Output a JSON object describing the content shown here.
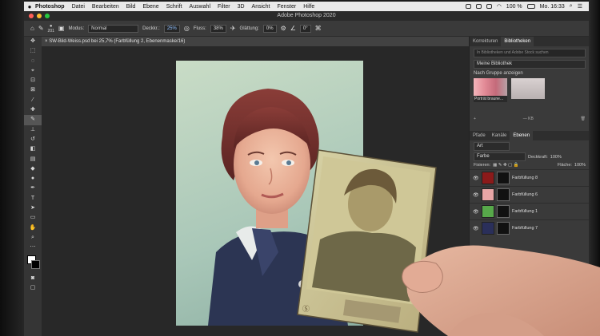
{
  "menubar": {
    "items": [
      "Photoshop",
      "Datei",
      "Bearbeiten",
      "Bild",
      "Ebene",
      "Schrift",
      "Auswahl",
      "Filter",
      "3D",
      "Ansicht",
      "Fenster",
      "Hilfe"
    ],
    "battery": "100 %",
    "clock": "Mo. 16:33"
  },
  "window": {
    "title": "Adobe Photoshop 2020"
  },
  "options": {
    "brush_size": "201",
    "mode_label": "Modus:",
    "mode_value": "Normal",
    "opacity_label": "Deckkr.:",
    "opacity_value": "25%",
    "flow_label": "Fluss:",
    "flow_value": "38%",
    "smoothing_label": "Glättung:",
    "smoothing_value": "0%",
    "angle_value": "0°"
  },
  "document": {
    "tab": "SW-Bild-Weiss.psd bei 25,7% (Farbfüllung 2, Ebenenmaske/16)"
  },
  "libraries": {
    "tabs": [
      "Korrekturen",
      "Bibliotheken"
    ],
    "search_placeholder": "In Bibliotheken und Adobe Stock suchen",
    "library_name": "Meine Bibliothek",
    "group_label": "Nach Gruppe anzeigen",
    "item_label": "Porträt braune...",
    "size_label": "— KB"
  },
  "layers": {
    "tabs": [
      "Pfade",
      "Kanäle",
      "Ebenen"
    ],
    "kind_value": "Art",
    "blend_value": "Farbe",
    "opacity_label": "Deckkraft:",
    "opacity_value": "100%",
    "lock_label": "Fixieren:",
    "fill_label": "Fläche:",
    "fill_value": "100%",
    "rows": [
      {
        "name": "Farbfüllung 8",
        "color": "#8b1a1a"
      },
      {
        "name": "Farbfüllung 6",
        "color": "#e8a6a6"
      },
      {
        "name": "Farbfüllung 1",
        "color": "#57a84a"
      },
      {
        "name": "Farbfüllung 7",
        "color": "#2a2f5a"
      }
    ]
  },
  "colors": {
    "accent": "#2d8cf0"
  }
}
